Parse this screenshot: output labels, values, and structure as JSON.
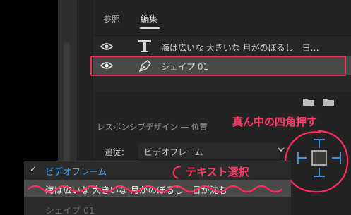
{
  "tabs": [
    {
      "label": "参照",
      "active": false
    },
    {
      "label": "編集",
      "active": true
    }
  ],
  "layers": [
    {
      "name": "海は広いな 大きいな 月がのぼるし　日…",
      "type_icon": "text-T-icon",
      "visible_icon": "eye-icon",
      "selected": false
    },
    {
      "name": "シェイプ 01",
      "type_icon": "pen-icon",
      "visible_icon": "eye-icon",
      "selected": true
    }
  ],
  "toolbar_icons": [
    "folder-icon",
    "folder-icon"
  ],
  "responsive": {
    "section_label": "レスポンシブデザイン — 位置",
    "follow_label": "追従：",
    "follow_value": "ビデオフレーム"
  },
  "dropdown": {
    "items": [
      {
        "label": "ビデオフレーム",
        "checked": true
      },
      {
        "label": "海は広いな 大きいな 月がのぼるし　日が沈む",
        "highlighted": true
      },
      {
        "label": "シェイプ 01",
        "dimmed": true
      }
    ]
  },
  "annotations": {
    "center_note": "真ん中の四角押す",
    "text_note": "テキスト選択",
    "color": "#ff3b6a"
  },
  "colors": {
    "accent_blue": "#4aa6ff",
    "annotation_red": "#e8345a"
  }
}
